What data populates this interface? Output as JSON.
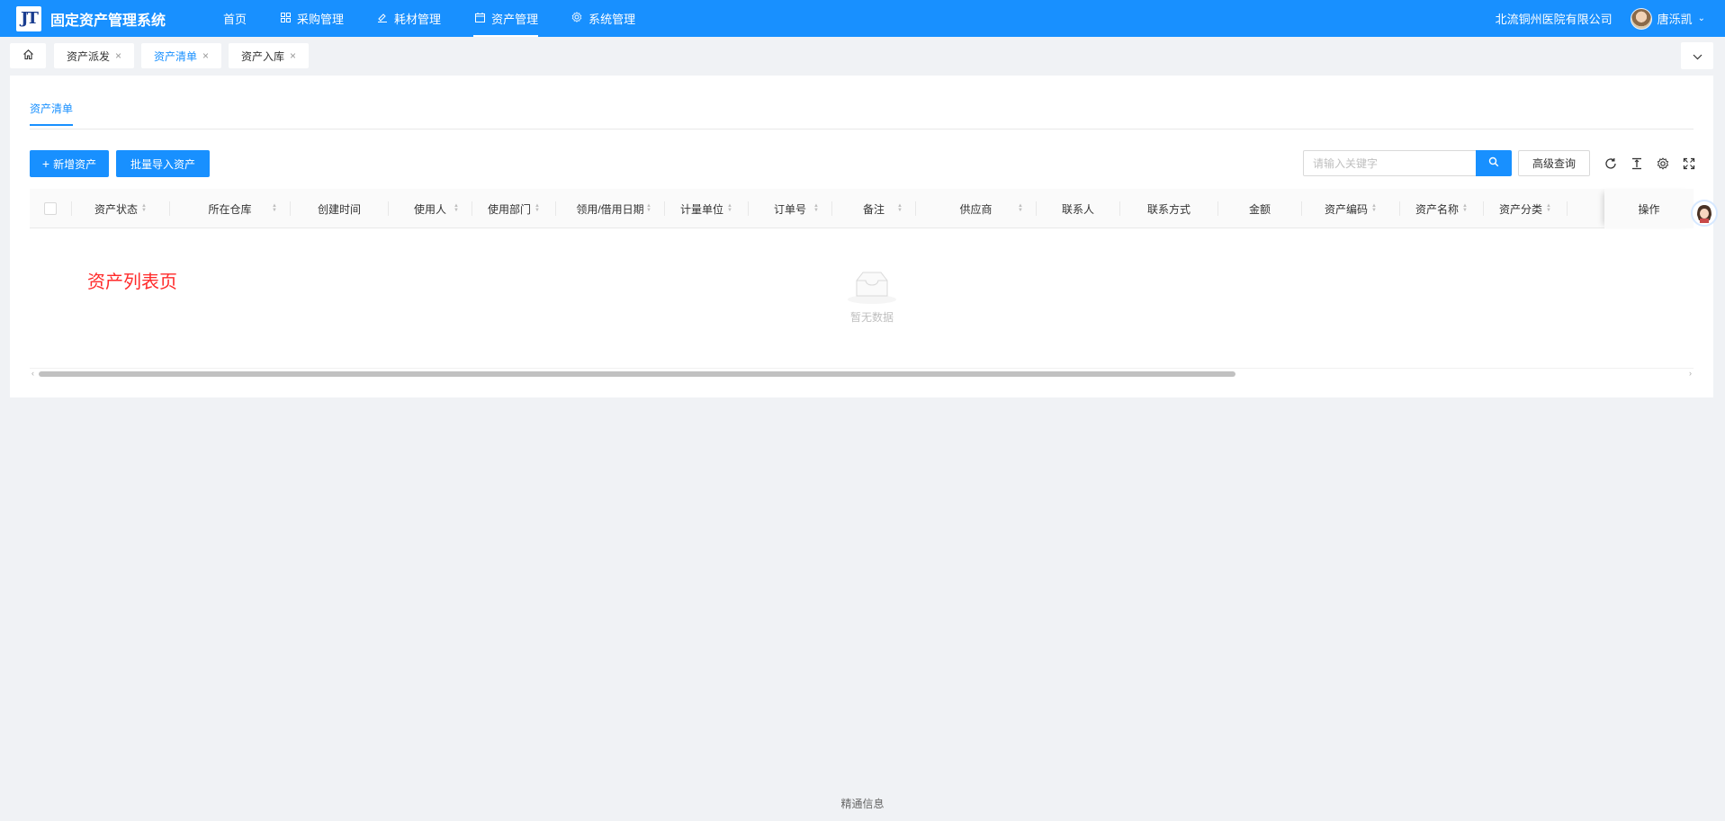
{
  "header": {
    "app_title": "固定资产管理系统",
    "logo_text": "JT",
    "nav": [
      {
        "label": "首页",
        "icon": ""
      },
      {
        "label": "采购管理",
        "icon": "grid-icon"
      },
      {
        "label": "耗材管理",
        "icon": "edit-icon"
      },
      {
        "label": "资产管理",
        "icon": "calendar-icon",
        "active": true
      },
      {
        "label": "系统管理",
        "icon": "gear-icon"
      }
    ],
    "company": "北流铜州医院有限公司",
    "user_name": "唐泺凯"
  },
  "tabs": {
    "items": [
      {
        "label": "资产派发"
      },
      {
        "label": "资产清单",
        "active": true
      },
      {
        "label": "资产入库"
      }
    ]
  },
  "main": {
    "subtab": "资产清单",
    "add_button": "新增资产",
    "import_button": "批量导入资产",
    "search_placeholder": "请输入关键字",
    "advanced_button": "高级查询",
    "page_label": "资产列表页",
    "empty_text": "暂无数据"
  },
  "table": {
    "columns": [
      "资产状态",
      "所在仓库",
      "创建时间",
      "使用人",
      "使用部门",
      "领用/借用日期",
      "计量单位",
      "订单号",
      "备注",
      "供应商",
      "联系人",
      "联系方式",
      "金额",
      "资产编码",
      "资产名称",
      "资产分类"
    ],
    "operation_column": "操作"
  },
  "footer": {
    "text": "精通信息"
  },
  "colors": {
    "primary": "#1890ff",
    "page_label": "#ff2a2a",
    "background": "#f0f2f5"
  }
}
